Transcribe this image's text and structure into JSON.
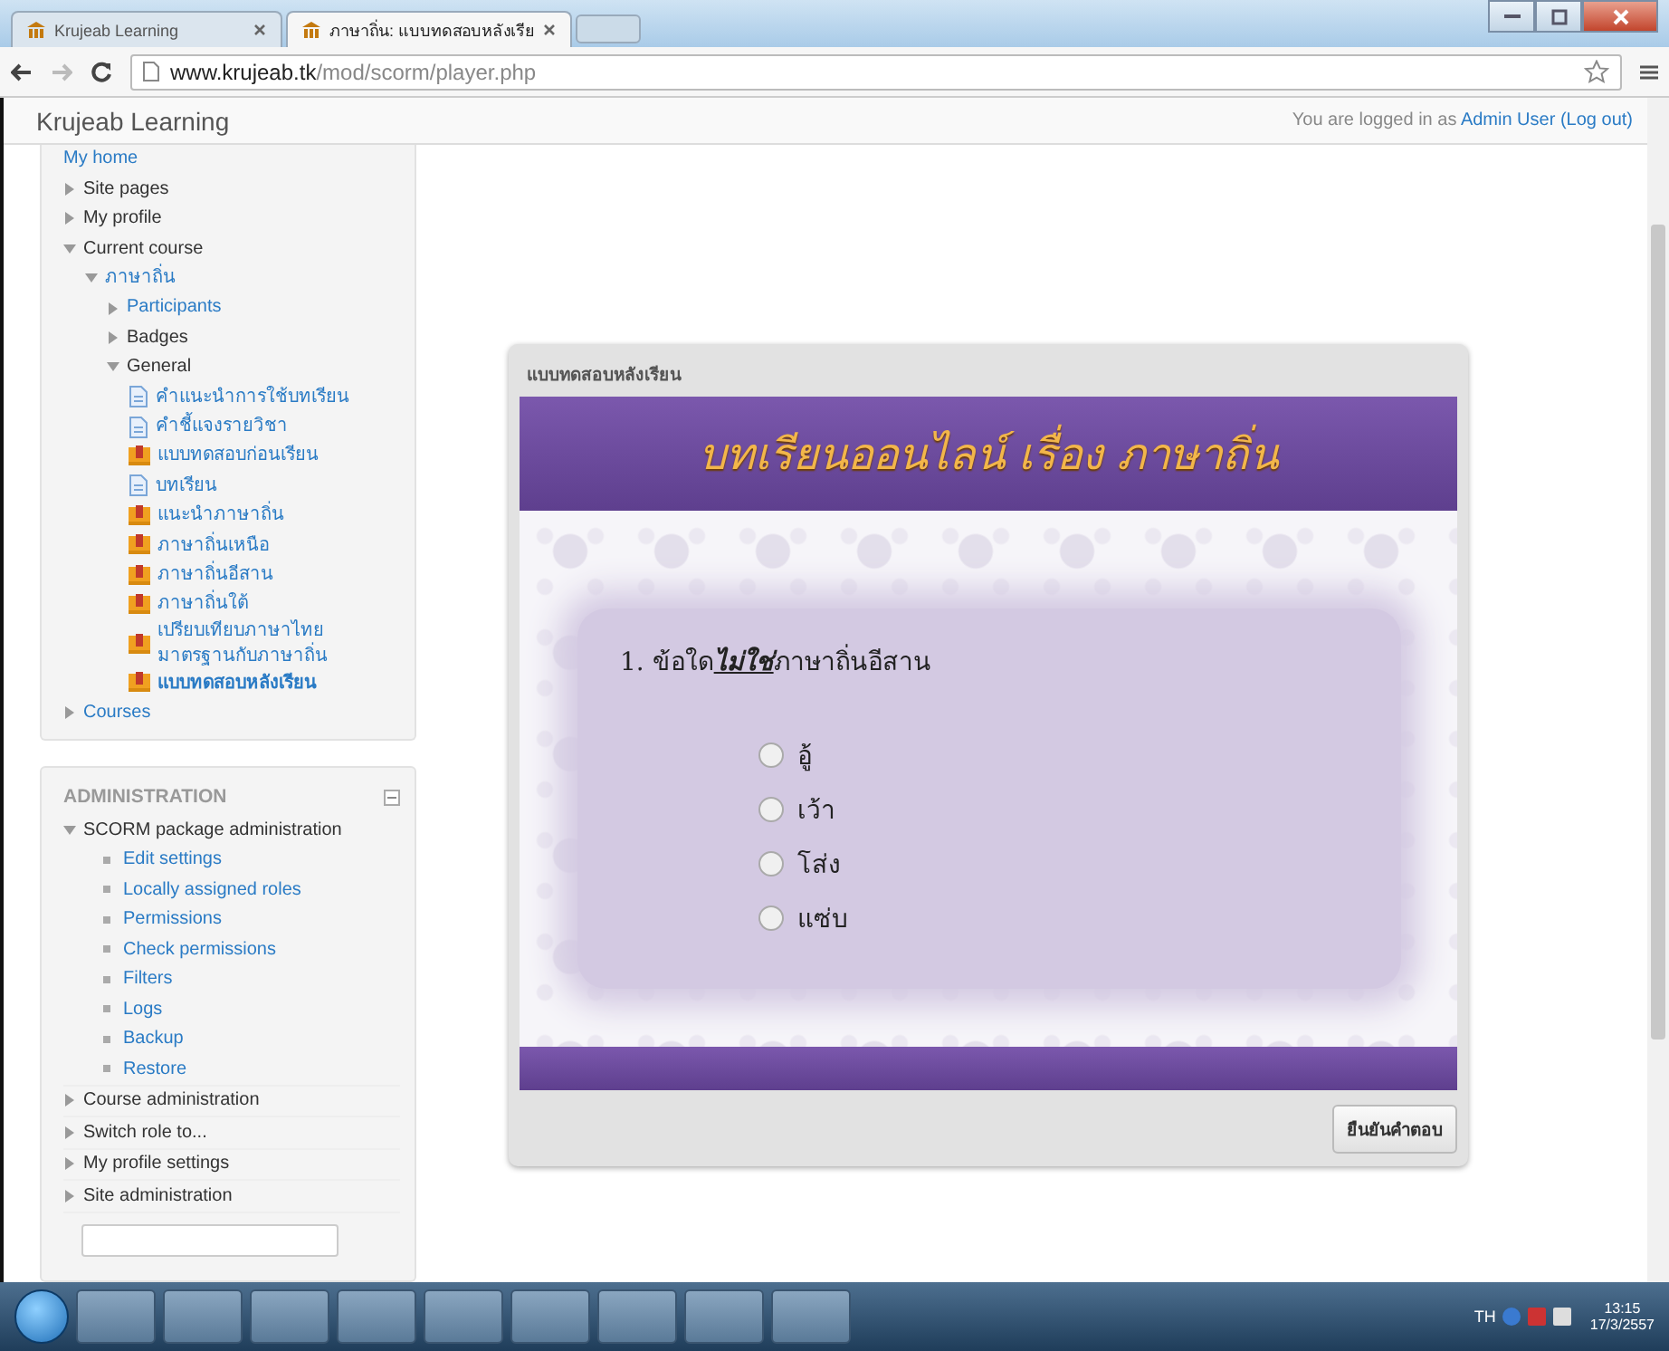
{
  "browser": {
    "tabs": [
      {
        "title": "Krujeab Learning",
        "selected": false
      },
      {
        "title": "ภาษาถิ่น: แบบทดสอบหลังเรีย",
        "selected": true
      }
    ],
    "url_domain": "www.krujeab.tk",
    "url_path": "/mod/scorm/player.php"
  },
  "header": {
    "site_name": "Krujeab Learning",
    "login_prefix": "You are logged in as",
    "user": "Admin User",
    "logout": "(Log out)"
  },
  "navigation": {
    "items": [
      {
        "label": "My home",
        "link": true
      },
      {
        "label": "Site pages",
        "link": false,
        "expanded": false
      },
      {
        "label": "My profile",
        "link": false,
        "expanded": false
      },
      {
        "label": "Current course",
        "link": false,
        "expanded": true,
        "children": [
          {
            "label": "ภาษาถิ่น",
            "link": true,
            "expanded": true,
            "children": [
              {
                "label": "Participants",
                "link": true,
                "expanded": false
              },
              {
                "label": "Badges",
                "link": false,
                "expanded": false
              },
              {
                "label": "General",
                "link": false,
                "expanded": true,
                "children": [
                  {
                    "label": "คำแนะนำการใช้บทเรียน",
                    "link": true,
                    "kind": "page",
                    "current": false
                  },
                  {
                    "label": "คำชี้แจงรายวิชา",
                    "link": true,
                    "kind": "page",
                    "current": false
                  },
                  {
                    "label": "แบบทดสอบก่อนเรียน",
                    "link": true,
                    "kind": "scorm",
                    "current": false
                  },
                  {
                    "label": "บทเรียน",
                    "link": true,
                    "kind": "page",
                    "current": false
                  },
                  {
                    "label": "แนะนำภาษาถิ่น",
                    "link": true,
                    "kind": "scorm",
                    "current": false
                  },
                  {
                    "label": "ภาษาถิ่นเหนือ",
                    "link": true,
                    "kind": "scorm",
                    "current": false
                  },
                  {
                    "label": "ภาษาถิ่นอีสาน",
                    "link": true,
                    "kind": "scorm",
                    "current": false
                  },
                  {
                    "label": "ภาษาถิ่นใต้",
                    "link": true,
                    "kind": "scorm",
                    "current": false
                  },
                  {
                    "label": "เปรียบเทียบภาษาไทยมาตรฐานกับภาษาถิ่น",
                    "link": true,
                    "kind": "scorm",
                    "current": false
                  },
                  {
                    "label": "แบบทดสอบหลังเรียน",
                    "link": true,
                    "kind": "scorm",
                    "current": true
                  }
                ]
              }
            ]
          }
        ]
      },
      {
        "label": "Courses",
        "link": true,
        "expanded": false
      }
    ]
  },
  "administration": {
    "title": "ADMINISTRATION",
    "items": [
      {
        "label": "SCORM package administration",
        "link": false,
        "expanded": true,
        "children": [
          {
            "label": "Edit settings",
            "link": true,
            "kind": "bullet"
          },
          {
            "label": "Locally assigned roles",
            "link": true,
            "kind": "bullet"
          },
          {
            "label": "Permissions",
            "link": true,
            "kind": "bullet"
          },
          {
            "label": "Check permissions",
            "link": true,
            "kind": "bullet"
          },
          {
            "label": "Filters",
            "link": true,
            "kind": "bullet"
          },
          {
            "label": "Logs",
            "link": true,
            "kind": "bullet"
          },
          {
            "label": "Backup",
            "link": true,
            "kind": "bullet"
          },
          {
            "label": "Restore",
            "link": true,
            "kind": "bullet"
          }
        ]
      },
      {
        "label": "Course administration",
        "link": false,
        "expanded": false
      },
      {
        "label": "Switch role to...",
        "link": false,
        "expanded": false
      },
      {
        "label": "My profile settings",
        "link": false,
        "expanded": false
      },
      {
        "label": "Site administration",
        "link": false,
        "expanded": false
      }
    ]
  },
  "scorm": {
    "title": "แบบทดสอบหลังเรียน",
    "banner": "บทเรียนออนไลน์ เรื่อง ภาษาถิ่น",
    "question": {
      "before": "1. ข้อใด",
      "emphasis": "ไม่ใช่",
      "after": "ภาษาถิ่นอีสาน"
    },
    "options": [
      {
        "label": "อู้",
        "selected": false
      },
      {
        "label": "เว้า",
        "selected": false
      },
      {
        "label": "โส่ง",
        "selected": false
      },
      {
        "label": "แซ่บ",
        "selected": false
      }
    ],
    "submit": "ยืนยันคำตอบ"
  },
  "taskbar": {
    "language": "TH",
    "time": "13:15",
    "date": "17/3/2557"
  }
}
